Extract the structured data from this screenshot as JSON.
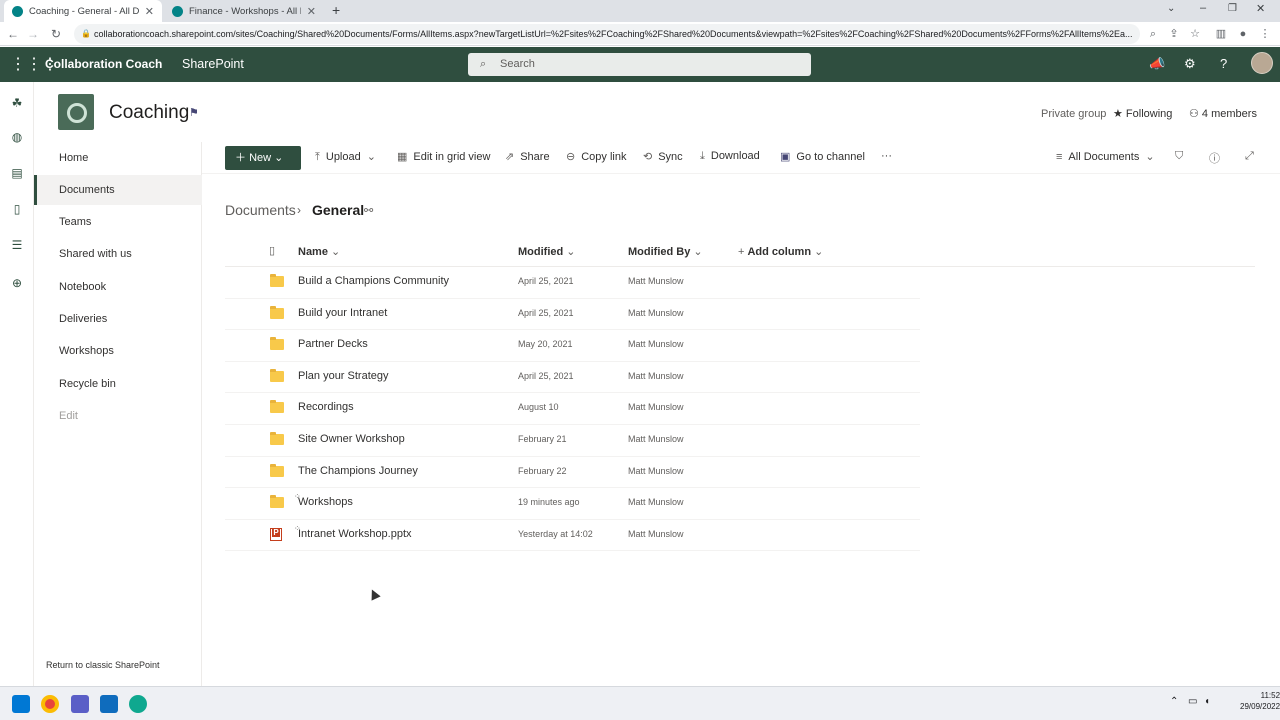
{
  "browser": {
    "tabs": [
      {
        "title": "Coaching - General - All Docume",
        "close": "✕"
      },
      {
        "title": "Finance - Workshops - All Docu",
        "close": "✕"
      }
    ],
    "new_tab": "+",
    "url": "collaborationcoach.sharepoint.com/sites/Coaching/Shared%20Documents/Forms/AllItems.aspx?newTargetListUrl=%2Fsites%2FCoaching%2FShared%20Documents&viewpath=%2Fsites%2FCoaching%2FShared%20Documents%2FForms%2FAllItems%2Ea..."
  },
  "suite": {
    "app_name": "Collaboration Coach",
    "product": "SharePoint",
    "search_placeholder": "Search"
  },
  "site": {
    "title": "Coaching",
    "privacy": "Private group",
    "following": "Following",
    "members": "4 members"
  },
  "leftnav": {
    "items": [
      "Home",
      "Documents",
      "Teams",
      "Shared with us",
      "Notebook",
      "Deliveries",
      "Workshops",
      "Recycle bin",
      "Edit"
    ],
    "selected": "Documents",
    "classic_link": "Return to classic SharePoint"
  },
  "commands": {
    "new": "New",
    "upload": "Upload",
    "grid": "Edit in grid view",
    "share": "Share",
    "copy_link": "Copy link",
    "sync": "Sync",
    "download": "Download",
    "channel": "Go to channel",
    "more": "···",
    "view": "All Documents"
  },
  "breadcrumb": {
    "root": "Documents",
    "current": "General"
  },
  "columns": {
    "name": "Name",
    "modified": "Modified",
    "modified_by": "Modified By",
    "add": "Add column"
  },
  "rows": [
    {
      "name": "Build a Champions Community",
      "modified": "April 25, 2021",
      "by": "Matt Munslow",
      "type": "folder"
    },
    {
      "name": "Build your Intranet",
      "modified": "April 25, 2021",
      "by": "Matt Munslow",
      "type": "folder"
    },
    {
      "name": "Partner Decks",
      "modified": "May 20, 2021",
      "by": "Matt Munslow",
      "type": "folder"
    },
    {
      "name": "Plan your Strategy",
      "modified": "April 25, 2021",
      "by": "Matt Munslow",
      "type": "folder"
    },
    {
      "name": "Recordings",
      "modified": "August 10",
      "by": "Matt Munslow",
      "type": "folder"
    },
    {
      "name": "Site Owner Workshop",
      "modified": "February 21",
      "by": "Matt Munslow",
      "type": "folder"
    },
    {
      "name": "The Champions Journey",
      "modified": "February 22",
      "by": "Matt Munslow",
      "type": "folder"
    },
    {
      "name": "Workshops",
      "modified": "19 minutes ago",
      "by": "Matt Munslow",
      "type": "folder"
    },
    {
      "name": "Intranet Workshop.pptx",
      "modified": "Yesterday at 14:02",
      "by": "Matt Munslow",
      "type": "pptx"
    }
  ],
  "taskbar": {
    "time": "11:52",
    "date": "29/09/2022"
  },
  "colors": {
    "suite": "#2f4e3f",
    "accent": "#2f4e3f"
  }
}
